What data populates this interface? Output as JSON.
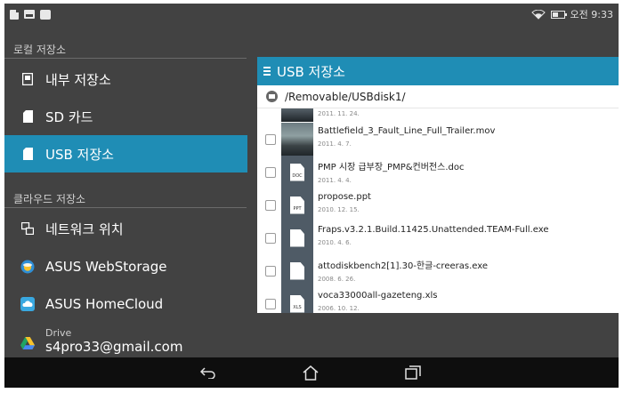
{
  "status_bar": {
    "left_icons": [
      "document-icon",
      "image-icon",
      "shopping-bag-icon"
    ],
    "right_icons": [
      "wifi-icon",
      "battery-icon"
    ],
    "time": "오전 9:33"
  },
  "sidebar": {
    "local_section_title": "로컬 저장소",
    "local_items": [
      {
        "label": "내부 저장소",
        "icon": "internal-storage-icon"
      },
      {
        "label": "SD 카드",
        "icon": "sd-card-icon"
      },
      {
        "label": "USB 저장소",
        "icon": "usb-icon",
        "active": true
      }
    ],
    "cloud_section_title": "클라우드 저장소",
    "cloud_items": [
      {
        "label": "네트워크 위치",
        "icon": "network-icon"
      },
      {
        "label": "ASUS WebStorage",
        "icon": "webstorage-icon"
      },
      {
        "label": "ASUS HomeCloud",
        "icon": "homecloud-icon"
      },
      {
        "label": "Drive",
        "account": "s4pro33@gmail.com",
        "icon": "google-drive-icon"
      }
    ]
  },
  "panel": {
    "title": "USB 저장소",
    "path": "/Removable/USBdisk1/",
    "files": [
      {
        "name": "",
        "date": "2011. 11. 24.",
        "type": "video"
      },
      {
        "name": "Battlefield_3_Fault_Line_Full_Trailer.mov",
        "date": "2011. 4. 7.",
        "type": "video"
      },
      {
        "name": "PMP 시장 급부장_PMP&컨버전스.doc",
        "date": "2011. 4. 4.",
        "type": "doc",
        "badge": "DOC"
      },
      {
        "name": "propose.ppt",
        "date": "2010. 12. 15.",
        "type": "ppt",
        "badge": "PPT"
      },
      {
        "name": "Fraps.v3.2.1.Build.11425.Unattended.TEAM-Full.exe",
        "date": "2010. 4. 6.",
        "type": "exe",
        "badge": ""
      },
      {
        "name": "attodiskbench2[1].30-한글-creeras.exe",
        "date": "2008. 6. 26.",
        "type": "exe",
        "badge": ""
      },
      {
        "name": "voca33000all-gazeteng.xls",
        "date": "2006. 10. 12.",
        "type": "xls",
        "badge": "XLS"
      }
    ]
  },
  "nav_bar": {
    "buttons": [
      "back-icon",
      "home-icon",
      "recent-apps-icon"
    ]
  },
  "colors": {
    "accent": "#1f8db5",
    "background": "#424242",
    "navbar": "#0e0e0e"
  }
}
